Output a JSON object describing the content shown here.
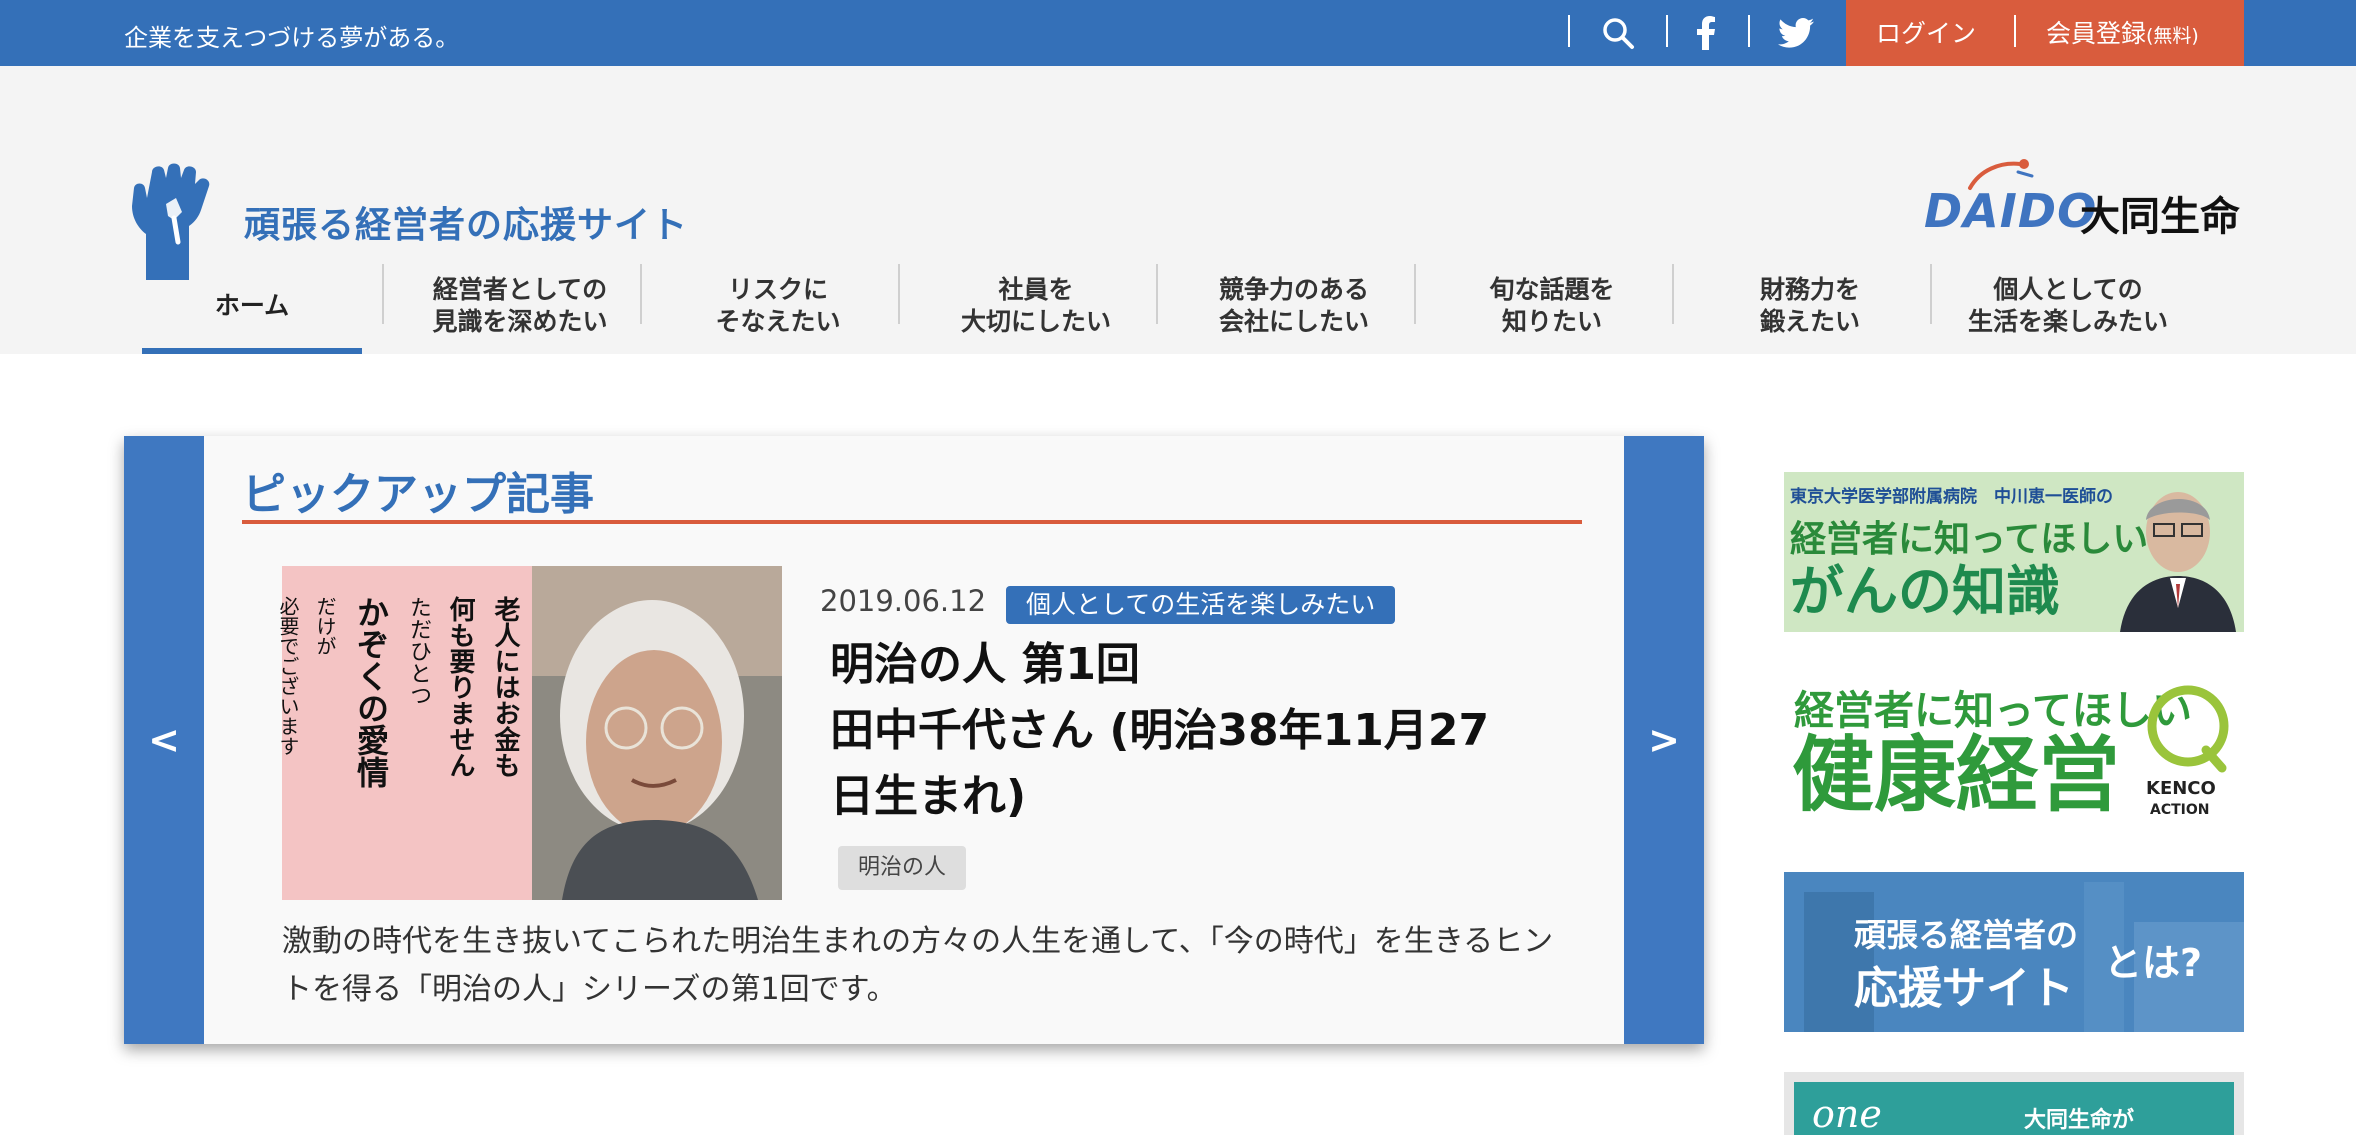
{
  "topbar": {
    "tagline": "企業を支えつづける夢がある。",
    "icons": {
      "search": "search-icon",
      "facebook": "facebook-icon",
      "twitter": "twitter-icon"
    },
    "login_label": "ログイン",
    "register_label": "会員登録",
    "register_note": "(無料)"
  },
  "header": {
    "site_name": "頑張る経営者の応援サイト",
    "brand_roman": "DAIDO",
    "brand_name": "大同生命"
  },
  "nav": {
    "items": [
      {
        "line1": "ホーム",
        "line2": ""
      },
      {
        "line1": "経営者としての",
        "line2": "見識を深めたい"
      },
      {
        "line1": "リスクに",
        "line2": "そなえたい"
      },
      {
        "line1": "社員を",
        "line2": "大切にしたい"
      },
      {
        "line1": "競争力のある",
        "line2": "会社にしたい"
      },
      {
        "line1": "旬な話題を",
        "line2": "知りたい"
      },
      {
        "line1": "財務力を",
        "line2": "鍛えたい"
      },
      {
        "line1": "個人としての",
        "line2": "生活を楽しみたい"
      }
    ]
  },
  "pickup": {
    "title": "ピックアップ記事",
    "prev_label": "<",
    "next_label": ">",
    "article": {
      "date": "2019.06.12",
      "category": "個人としての生活を楽しみたい",
      "title_line1": "明治の人 第1回",
      "title_line2": "田中千代さん (明治38年11月27",
      "title_line3": "日生まれ)",
      "tag": "明治の人",
      "description": "激動の時代を生き抜いてこられた明治生まれの方々の人生を通して、「今の時代」を生きるヒントを得る「明治の人」シリーズの第1回です。",
      "calligraphy": [
        "老人にはお金も",
        "何も要りません",
        "ただひとつ",
        "かぞくの愛情",
        "だけが",
        "必要でございます"
      ]
    }
  },
  "sidebar": {
    "banner1": {
      "small": "東京大学医学部附属病院　中川恵一医師の",
      "line2": "経営者に知ってほしい",
      "line3": "がんの知識"
    },
    "banner2": {
      "line1": "経営者に知ってほしい",
      "line2": "健康経営",
      "mark": "KENCO",
      "mark2": "ACTION"
    },
    "banner3": {
      "line1": "頑張る経営者の",
      "line2": "応援サイト",
      "line3": "とは?"
    },
    "banner4": {
      "one": "one",
      "text": "大同生命が"
    }
  },
  "colors": {
    "primary": "#3470b8",
    "accent": "#d95c3d",
    "arrow": "#3f78c1"
  }
}
